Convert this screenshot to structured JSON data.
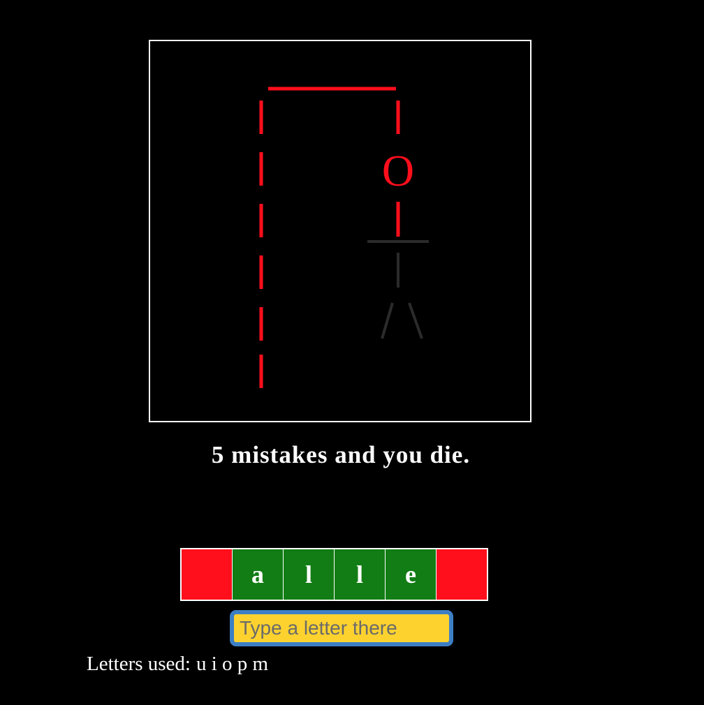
{
  "game": {
    "rules_text": "5 mistakes and you die.",
    "head_glyph": "O",
    "mistakes_made": 4,
    "max_mistakes": 5
  },
  "word": {
    "tiles": [
      {
        "letter": "",
        "revealed": false
      },
      {
        "letter": "a",
        "revealed": true
      },
      {
        "letter": "l",
        "revealed": true
      },
      {
        "letter": "l",
        "revealed": true
      },
      {
        "letter": "e",
        "revealed": true
      },
      {
        "letter": "",
        "revealed": false
      }
    ]
  },
  "input": {
    "value": "",
    "placeholder": "Type a letter there"
  },
  "letters_used": {
    "label": "Letters used:",
    "letters": "u i o p m"
  },
  "colors": {
    "gallows": "#ff0e1b",
    "body_inactive": "#2b2b2b",
    "hidden_tile": "#ff0e1b",
    "revealed_tile": "#127d15",
    "input_bg": "#fdd22f"
  }
}
